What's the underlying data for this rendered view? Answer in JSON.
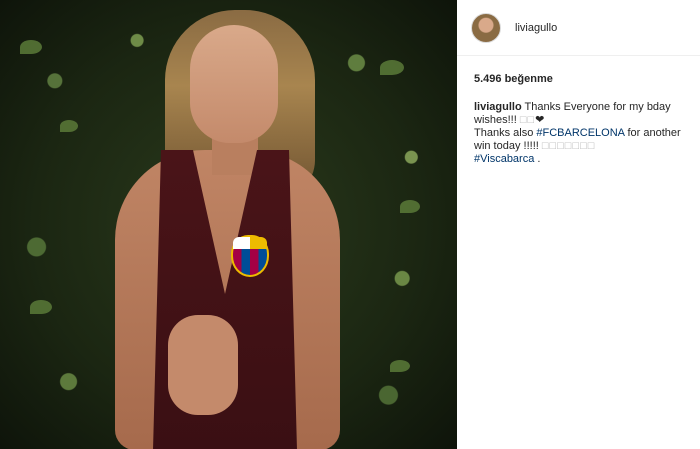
{
  "post": {
    "username": "liviagullo",
    "likes": "5.496 beğenme",
    "caption": {
      "user": "liviagullo",
      "line1": "Thanks Everyone for my bday wishes!!!",
      "line1_symbols": "□□",
      "heart": "❤",
      "line2_prefix": "Thanks also",
      "hashtag1": "#FCBARCELONA",
      "line2_suffix": "for another win today !!!!!",
      "line2_symbols": "□□□□□□□",
      "hashtag2": "#Viscabarca",
      "end": "."
    },
    "colors": {
      "hashtag": "#003569",
      "text": "#262626"
    }
  }
}
